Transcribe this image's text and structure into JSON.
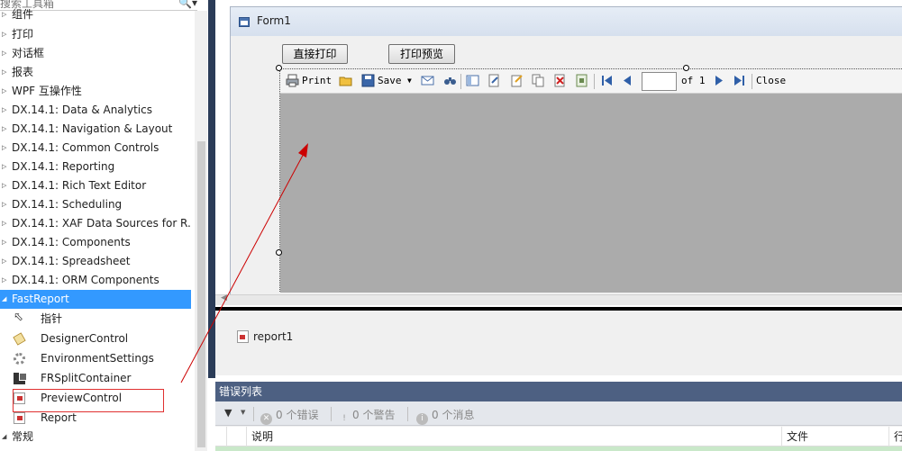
{
  "toolbox": {
    "search_placeholder": "搜索工具箱",
    "search_icon": "magnifier",
    "categories": [
      {
        "label": "组件"
      },
      {
        "label": "打印"
      },
      {
        "label": "对话框"
      },
      {
        "label": "报表"
      },
      {
        "label": "WPF 互操作性"
      },
      {
        "label": "DX.14.1: Data & Analytics"
      },
      {
        "label": "DX.14.1: Navigation & Layout"
      },
      {
        "label": "DX.14.1: Common Controls"
      },
      {
        "label": "DX.14.1: Reporting"
      },
      {
        "label": "DX.14.1: Rich Text Editor"
      },
      {
        "label": "DX.14.1: Scheduling"
      },
      {
        "label": "DX.14.1: XAF Data Sources for R..."
      },
      {
        "label": "DX.14.1: Components"
      },
      {
        "label": "DX.14.1: Spreadsheet"
      },
      {
        "label": "DX.14.1: ORM Components"
      },
      {
        "label": "FastReport",
        "expanded": true,
        "selected": true
      }
    ],
    "fastreport_items": [
      {
        "label": "指针",
        "icon": "pointer-icon"
      },
      {
        "label": "DesignerControl",
        "icon": "designer-icon"
      },
      {
        "label": "EnvironmentSettings",
        "icon": "settings-icon"
      },
      {
        "label": "FRSplitContainer",
        "icon": "split-container-icon"
      },
      {
        "label": "PreviewControl",
        "icon": "preview-icon",
        "highlighted": true
      },
      {
        "label": "Report",
        "icon": "report-icon"
      }
    ],
    "footer_category": "常规"
  },
  "form": {
    "title": "Form1",
    "buttons": {
      "direct_print": "直接打印",
      "print_preview": "打印预览"
    },
    "preview_toolbar": {
      "print_label": "Print",
      "save_label": "Save",
      "page_value": "",
      "of_label": "of 1",
      "close_label": "Close"
    }
  },
  "tray": {
    "component": "report1"
  },
  "error_list": {
    "title": "错误列表",
    "errors": "0 个错误",
    "warnings": "0 个警告",
    "messages": "0 个消息",
    "columns": [
      "说明",
      "文件",
      "行"
    ]
  },
  "colors": {
    "selection": "#3399ff",
    "highlight_box": "#e03030",
    "arrow": "#cc0000",
    "preview_canvas": "#ababab",
    "error_list_title": "#4d6082",
    "ide_border": "#2b3c58"
  }
}
